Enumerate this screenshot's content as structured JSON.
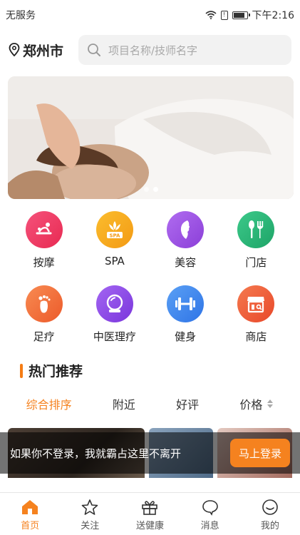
{
  "status_bar": {
    "carrier": "无服务",
    "time": "下午2:16",
    "sim_label": "!"
  },
  "header": {
    "city": "郑州市",
    "search_placeholder": "项目名称/技师名字"
  },
  "banner": {
    "pages": 2,
    "active_page": 2
  },
  "categories": [
    {
      "label": "按摩",
      "icon": "massage-icon",
      "color": "#f0365f"
    },
    {
      "label": "SPA",
      "icon": "spa-lotus-icon",
      "color": "#f7a81b",
      "icon_text": "SPA"
    },
    {
      "label": "美容",
      "icon": "beauty-face-icon",
      "color": "#9b4fe0"
    },
    {
      "label": "门店",
      "icon": "store-cutlery-icon",
      "color": "#2bb67a"
    },
    {
      "label": "足疗",
      "icon": "foot-icon",
      "color": "#f06a3a"
    },
    {
      "label": "中医理疗",
      "icon": "crystal-ball-icon",
      "color": "#8c4de8"
    },
    {
      "label": "健身",
      "icon": "dumbbell-icon",
      "color": "#3a86f0"
    },
    {
      "label": "商店",
      "icon": "shop-icon",
      "color": "#f0613a"
    }
  ],
  "section": {
    "title": "热门推荐",
    "accent": "#f57c14"
  },
  "sort_tabs": [
    {
      "label": "综合排序",
      "active": true
    },
    {
      "label": "附近",
      "active": false
    },
    {
      "label": "好评",
      "active": false
    },
    {
      "label": "价格",
      "active": false
    }
  ],
  "login_prompt": {
    "text": "如果你不登录，我就霸占这里不离开",
    "button": "马上登录"
  },
  "tabbar": [
    {
      "label": "首页",
      "icon": "home-icon",
      "active": true
    },
    {
      "label": "关注",
      "icon": "star-icon",
      "active": false
    },
    {
      "label": "送健康",
      "icon": "gift-icon",
      "active": false
    },
    {
      "label": "消息",
      "icon": "message-icon",
      "active": false
    },
    {
      "label": "我的",
      "icon": "profile-icon",
      "active": false
    }
  ],
  "colors": {
    "accent": "#f5821f"
  }
}
